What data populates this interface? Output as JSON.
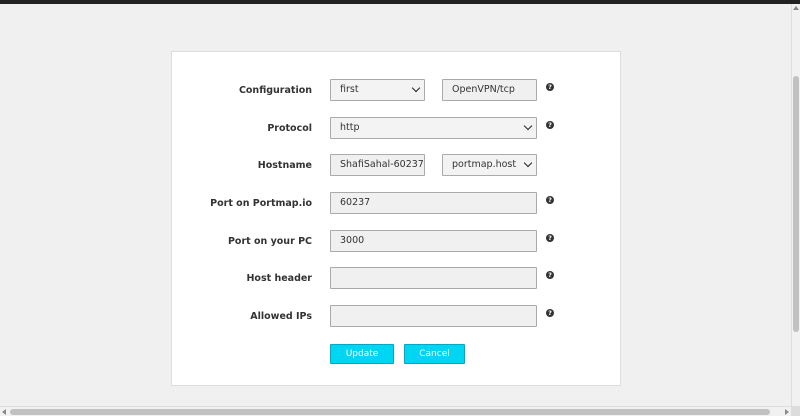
{
  "form": {
    "configuration": {
      "label": "Configuration",
      "value": "first",
      "server": "OpenVPN/tcp"
    },
    "protocol": {
      "label": "Protocol",
      "value": "http"
    },
    "hostname": {
      "label": "Hostname",
      "value": "ShafiSahal-60237",
      "domain": "portmap.host"
    },
    "port_portmap": {
      "label": "Port on Portmap.io",
      "value": "60237"
    },
    "port_pc": {
      "label": "Port on your PC",
      "value": "3000"
    },
    "host_header": {
      "label": "Host header",
      "value": ""
    },
    "allowed_ips": {
      "label": "Allowed IPs",
      "value": ""
    },
    "help_glyph": "?"
  },
  "buttons": {
    "update": "Update",
    "cancel": "Cancel"
  },
  "colors": {
    "accent": "#00d5f2",
    "field_bg": "#f0f0f0",
    "page_bg": "#f0f0f0"
  },
  "icons": {
    "help": "question-circle-icon",
    "dropdown": "chevron-down-icon"
  }
}
